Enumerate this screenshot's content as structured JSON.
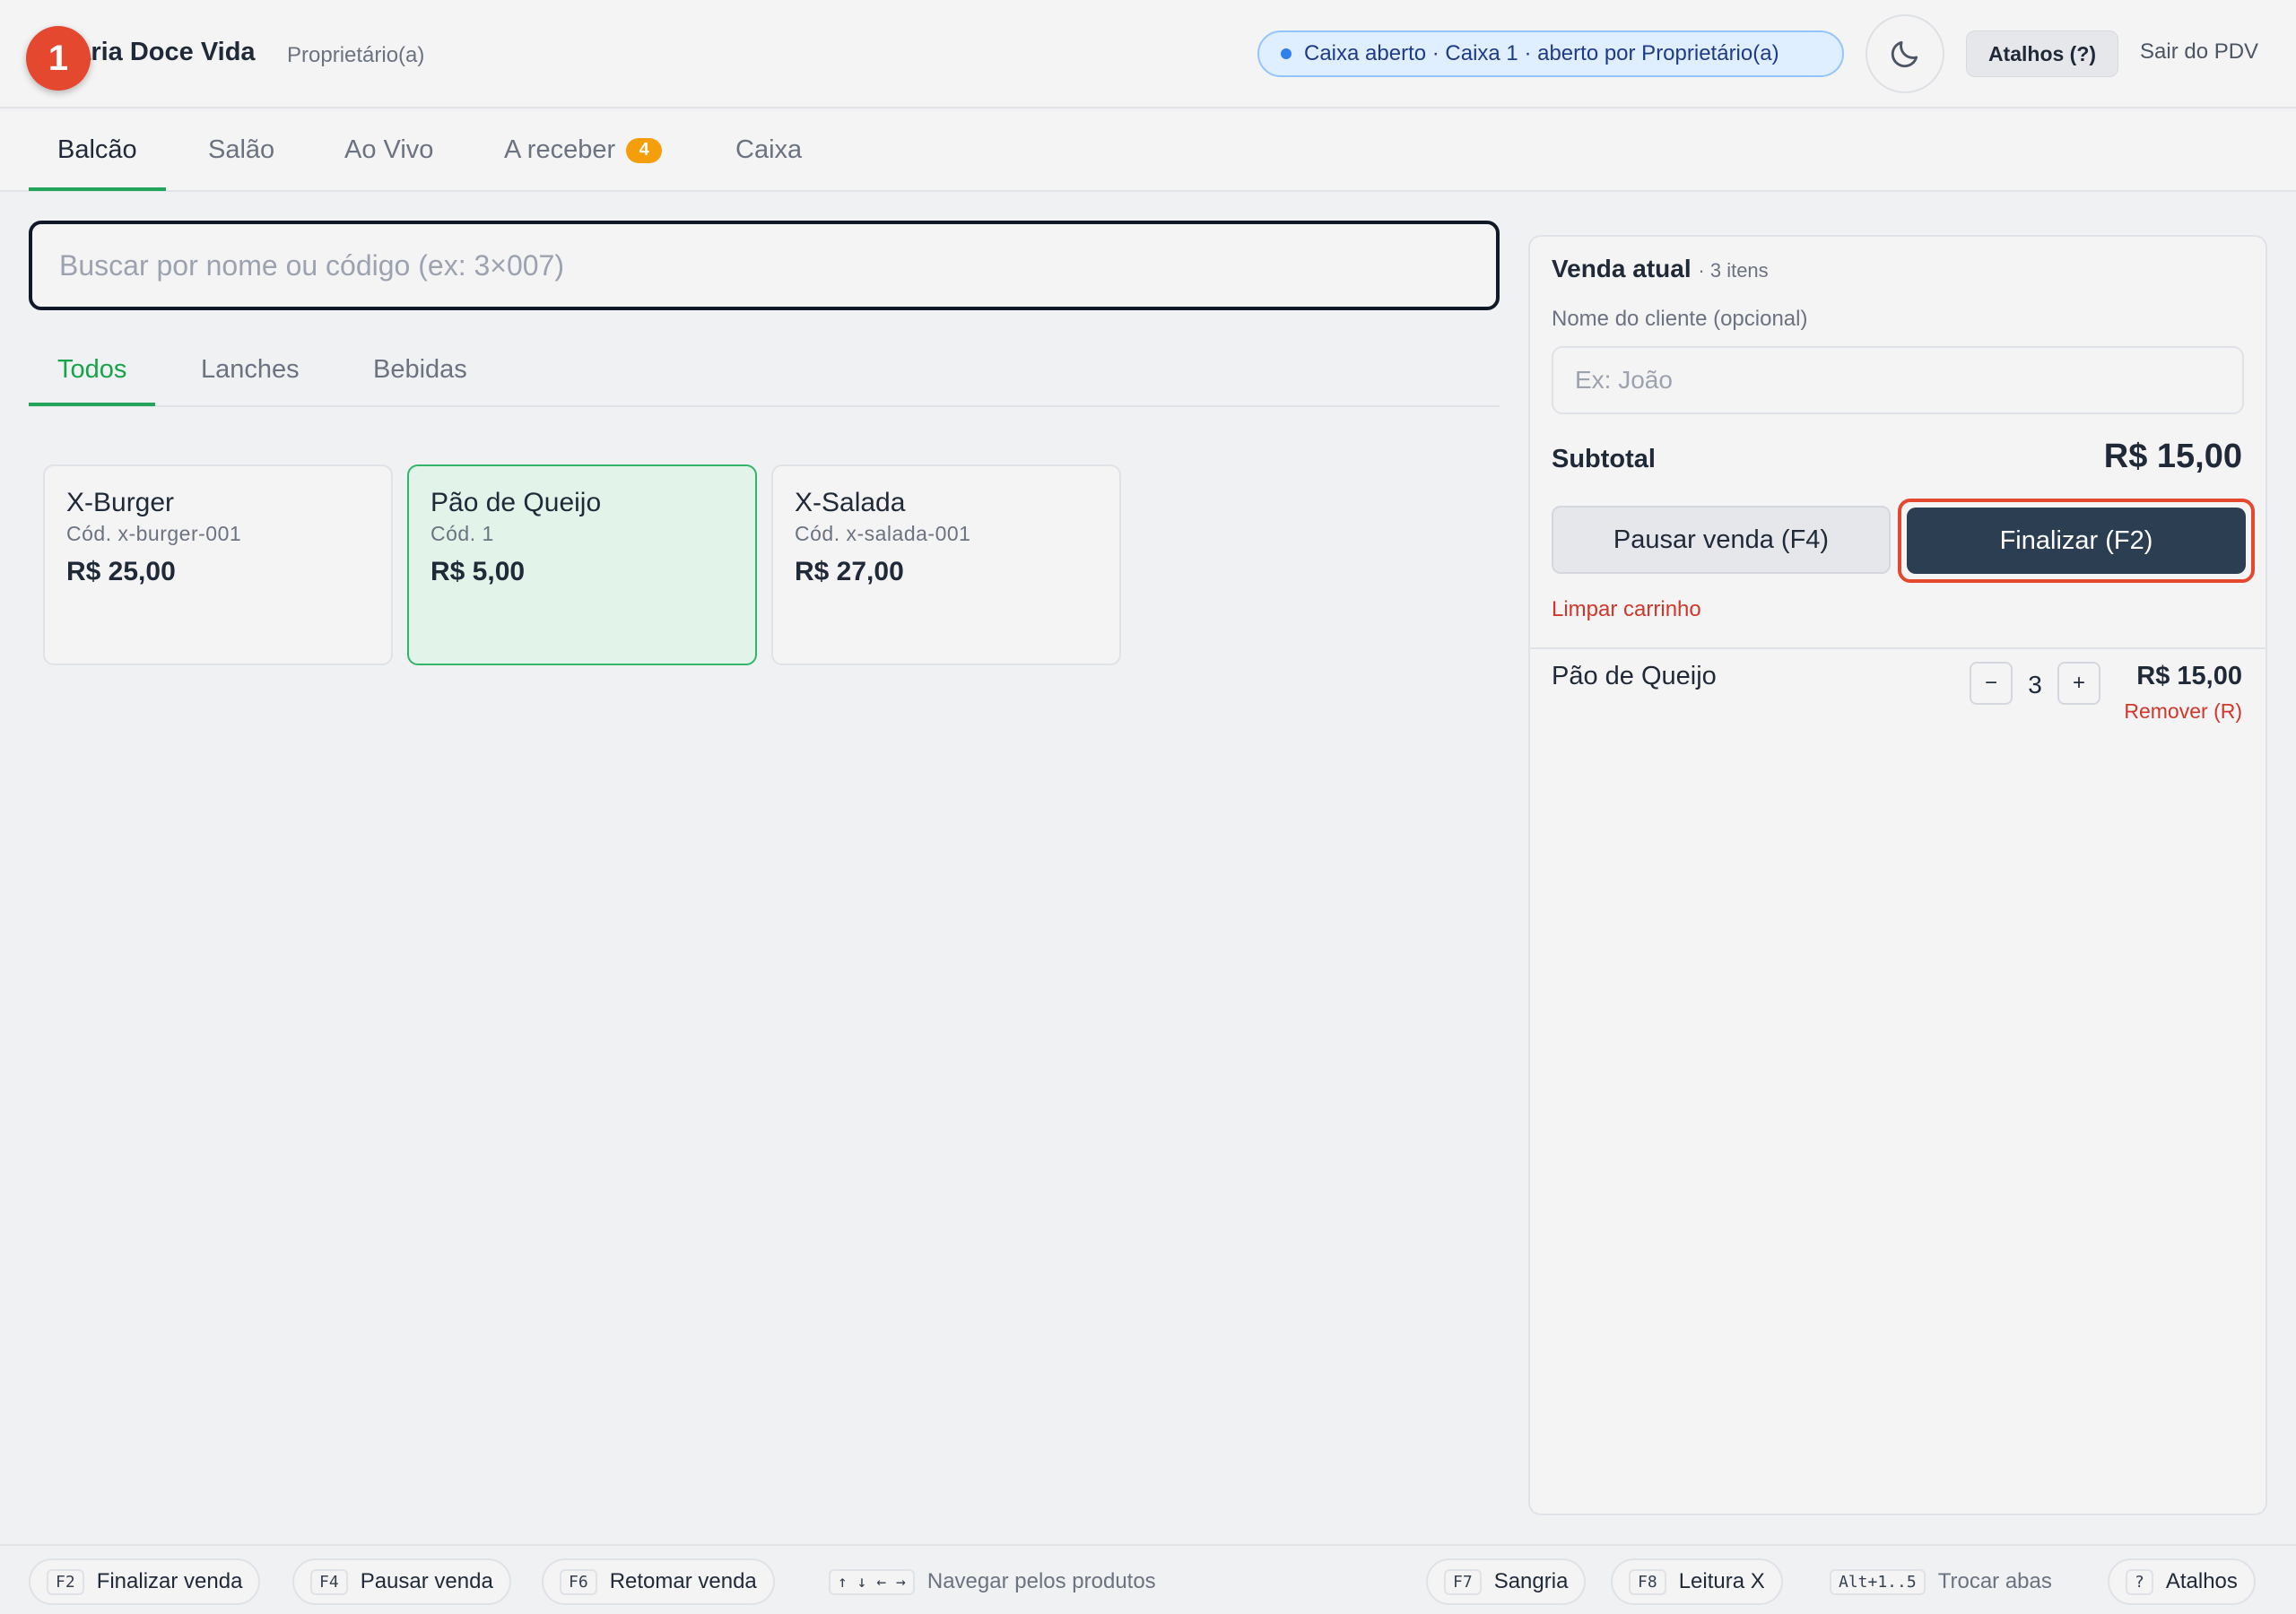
{
  "header": {
    "store_name": "Padaria Doce Vida",
    "role": "Proprietário(a)",
    "step_badge": "1",
    "status": "Caixa aberto · Caixa 1 · aberto por Proprietário(a)",
    "theme_icon": "moon-icon",
    "shortcuts_label": "Atalhos (?)",
    "exit_label": "Sair do PDV"
  },
  "main_tabs": [
    {
      "label": "Balcão",
      "active": true
    },
    {
      "label": "Salão"
    },
    {
      "label": "Ao Vivo"
    },
    {
      "label": "A receber",
      "badge": "4"
    },
    {
      "label": "Caixa"
    }
  ],
  "search": {
    "placeholder": "Buscar por nome ou código (ex: 3×007)"
  },
  "category_tabs": [
    {
      "label": "Todos",
      "active": true
    },
    {
      "label": "Lanches"
    },
    {
      "label": "Bebidas"
    }
  ],
  "products": [
    {
      "name": "X-Burger",
      "code": "Cód. x-burger-001",
      "price": "R$ 25,00"
    },
    {
      "name": "Pão de Queijo",
      "code": "Cód. 1",
      "price": "R$ 5,00",
      "selected": true
    },
    {
      "name": "X-Salada",
      "code": "Cód. x-salada-001",
      "price": "R$ 27,00"
    }
  ],
  "sale": {
    "title": "Venda atual",
    "count": "· 3 itens",
    "customer_label": "Nome do cliente (opcional)",
    "customer_placeholder": "Ex: João",
    "subtotal_label": "Subtotal",
    "subtotal_value": "R$ 15,00",
    "pause_label": "Pausar venda (F4)",
    "finalize_label": "Finalizar (F2)",
    "clear_label": "Limpar carrinho",
    "items": [
      {
        "name": "Pão de Queijo",
        "qty": "3",
        "minus": "−",
        "plus": "+",
        "price": "R$ 15,00",
        "remove": "Remover (R)"
      }
    ]
  },
  "footer": [
    {
      "key": "F2",
      "label": "Finalizar venda"
    },
    {
      "key": "F4",
      "label": "Pausar venda"
    },
    {
      "key": "F6",
      "label": "Retomar venda"
    },
    {
      "key": "↑ ↓ ← →",
      "label": "Navegar pelos produtos"
    },
    {
      "key": "F7",
      "label": "Sangria"
    },
    {
      "key": "F8",
      "label": "Leitura X"
    },
    {
      "key": "Alt+1..5",
      "label": "Trocar abas"
    },
    {
      "key": "?",
      "label": "Atalhos"
    }
  ],
  "colors": {
    "accent_green": "#22a55b",
    "primary_dark": "#2c3e52",
    "danger": "#d0362a",
    "highlight": "#e4482f",
    "badge_orange": "#f59e0b"
  }
}
